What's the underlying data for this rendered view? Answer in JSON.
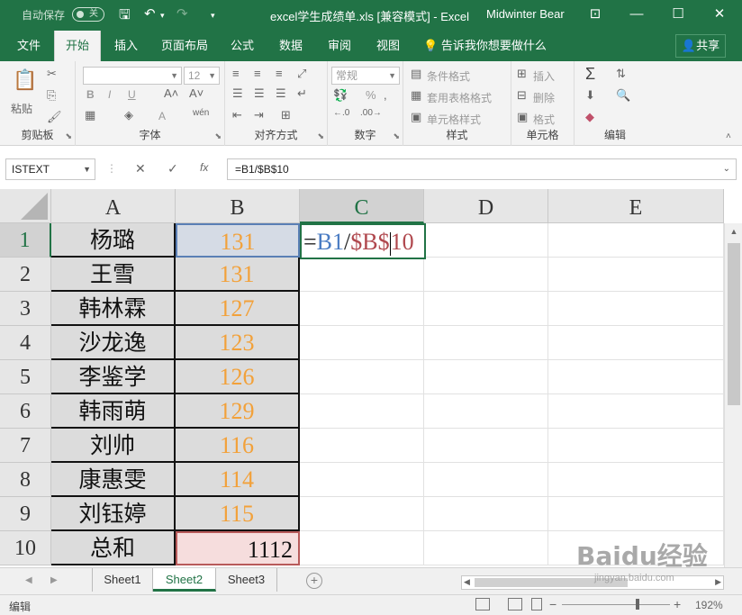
{
  "titlebar": {
    "autosave_label": "自动保存",
    "autosave_state": "关",
    "title": "excel学生成绩单.xls  [兼容模式]  -  Excel",
    "user": "Midwinter Bear"
  },
  "tabs": [
    "文件",
    "开始",
    "插入",
    "页面布局",
    "公式",
    "数据",
    "审阅",
    "视图"
  ],
  "active_tab": "开始",
  "tell_me": "告诉我你想要做什么",
  "share": "共享",
  "ribbon": {
    "clipboard": {
      "paste": "粘贴",
      "label": "剪贴板"
    },
    "font": {
      "size": "12",
      "label": "字体",
      "bold": "B",
      "italic": "I",
      "underline": "U",
      "font_color_glyph": "A"
    },
    "alignment": {
      "label": "对齐方式"
    },
    "number": {
      "format": "常规",
      "label": "数字",
      "percent": "%"
    },
    "styles": {
      "conditional": "条件格式",
      "table": "套用表格格式",
      "cell_styles": "单元格样式",
      "label": "样式"
    },
    "cells": {
      "insert": "插入",
      "delete": "删除",
      "format": "格式",
      "label": "单元格"
    },
    "editing": {
      "label": "编辑"
    }
  },
  "formula_bar": {
    "name_box": "ISTEXT",
    "fx": "fx",
    "formula": "=B1/$B$10"
  },
  "grid": {
    "columns": [
      "A",
      "B",
      "C",
      "D",
      "E"
    ],
    "selected_column": "C",
    "selected_row": "1",
    "rows": [
      {
        "num": "1",
        "name": "杨璐",
        "score": "131"
      },
      {
        "num": "2",
        "name": "王雪",
        "score": "131"
      },
      {
        "num": "3",
        "name": "韩林霖",
        "score": "127"
      },
      {
        "num": "4",
        "name": "沙龙逸",
        "score": "123"
      },
      {
        "num": "5",
        "name": "李鉴学",
        "score": "126"
      },
      {
        "num": "6",
        "name": "韩雨萌",
        "score": "129"
      },
      {
        "num": "7",
        "name": "刘帅",
        "score": "116"
      },
      {
        "num": "8",
        "name": "康惠雯",
        "score": "114"
      },
      {
        "num": "9",
        "name": "刘钰婷",
        "score": "115"
      },
      {
        "num": "10",
        "name": "总和",
        "score": "1112"
      }
    ],
    "edit_cell": {
      "ref": "C1",
      "parts": {
        "eq": "=",
        "ref1": "B1",
        "slash": "/",
        "ref2": "$B$10"
      }
    }
  },
  "sheets": [
    "Sheet1",
    "Sheet2",
    "Sheet3"
  ],
  "active_sheet": "Sheet2",
  "status": {
    "mode": "编辑",
    "zoom": "192%"
  },
  "watermark": {
    "brand": "Baidu经验",
    "url": "jingyan.baidu.com"
  },
  "colors": {
    "accent": "#217346",
    "score": "#f2a13a",
    "ref1": "#4a7cc3",
    "ref2": "#b0484e"
  }
}
